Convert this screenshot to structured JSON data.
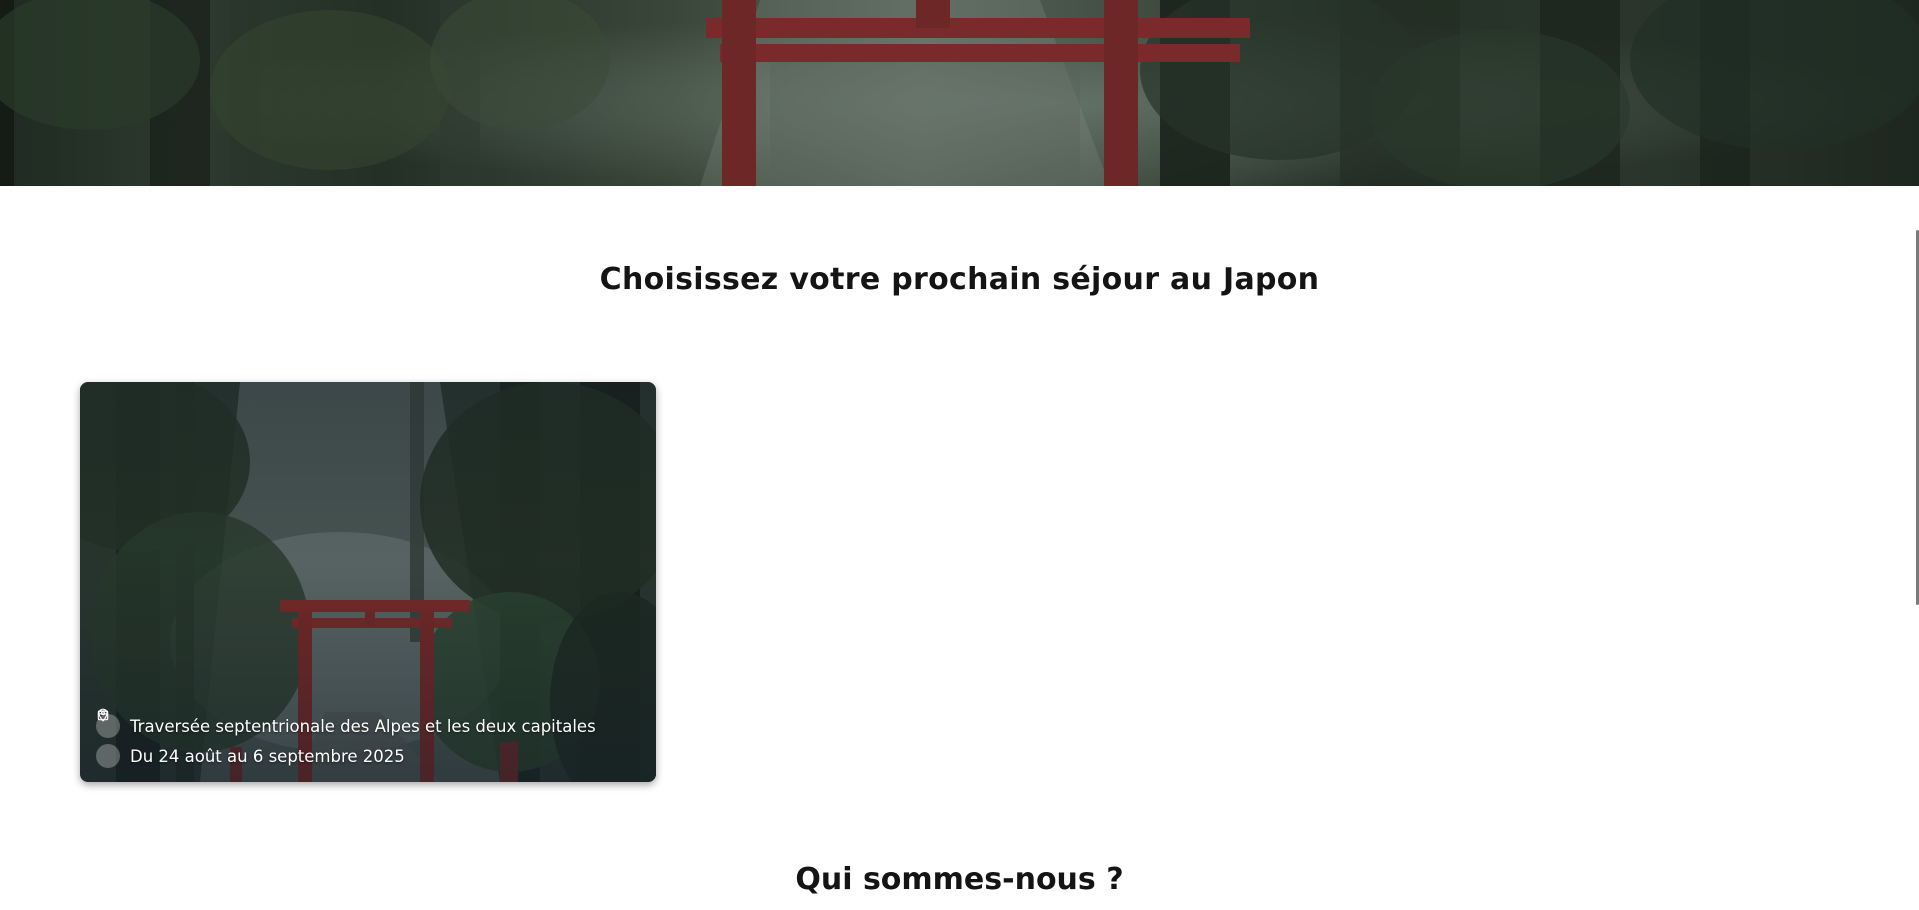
{
  "hero": {
    "image_alt": "torii-forest-banner"
  },
  "section": {
    "title": "Choisissez votre prochain séjour au Japon"
  },
  "cards": [
    {
      "location": "Traversée septentrionale des Alpes et les deux capitales",
      "dates": "Du 24 août au 6 septembre 2025",
      "location_icon": "map-pin-icon",
      "date_icon": "calendar-icon"
    }
  ],
  "about": {
    "title": "Qui sommes-nous ?"
  },
  "colors": {
    "torii_red": "#8a2a28",
    "title_text": "#141414",
    "card_text": "#ffffff"
  }
}
